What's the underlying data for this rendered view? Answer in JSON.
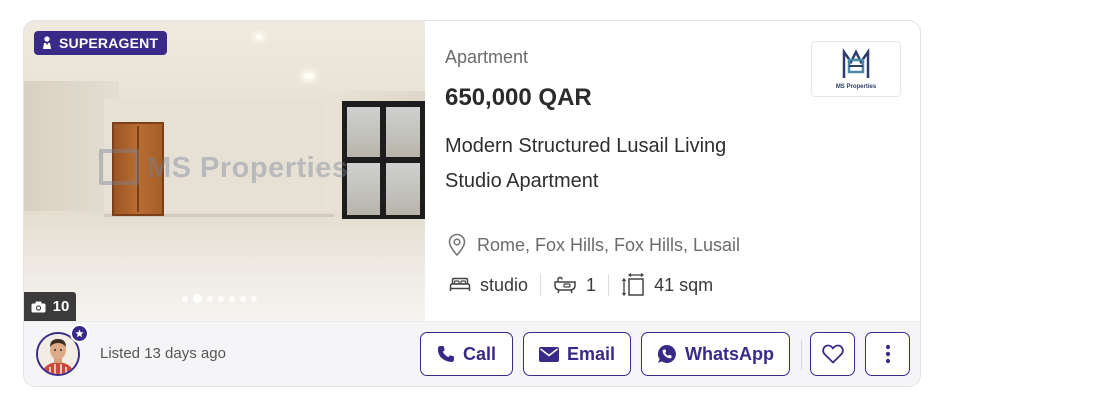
{
  "badge": {
    "label": "SUPERAGENT"
  },
  "photo": {
    "count": "10",
    "slides_total": 7,
    "slide_active": 1,
    "watermark": "MS Properties"
  },
  "listing": {
    "type": "Apartment",
    "price": "650,000 QAR",
    "title_line1": "Modern Structured Lusail Living",
    "title_line2": "Studio Apartment",
    "location": "Rome, Fox Hills, Fox Hills, Lusail",
    "bedrooms": "studio",
    "bathrooms": "1",
    "area": "41 sqm"
  },
  "agency": {
    "logo_text": "MS Properties"
  },
  "footer": {
    "listed": "Listed 13 days ago",
    "call_label": "Call",
    "email_label": "Email",
    "whatsapp_label": "WhatsApp"
  },
  "colors": {
    "brand": "#3a2a87",
    "text": "#2d2d2d",
    "muted": "#6b6b6b"
  }
}
